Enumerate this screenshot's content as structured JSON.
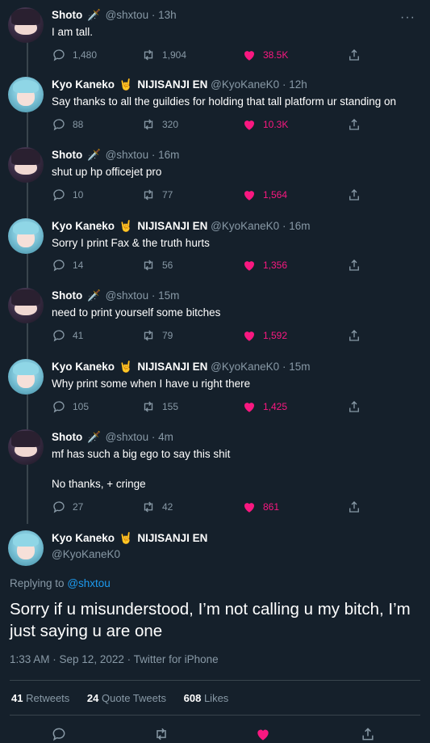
{
  "thread": [
    {
      "name": "Shoto",
      "emoji": "🗡️",
      "handle": "@shxtou",
      "time": "13h",
      "text": [
        "I am tall."
      ],
      "replies": "1,480",
      "retweets": "1,904",
      "likes": "38.5K"
    },
    {
      "name": "Kyo Kaneko",
      "emoji": "🤘",
      "suffix": "NIJISANJI EN",
      "handle": "@KyoKaneK0",
      "time": "12h",
      "text": [
        "Say thanks to all the guildies for holding that tall platform ur standing on"
      ],
      "replies": "88",
      "retweets": "320",
      "likes": "10.3K"
    },
    {
      "name": "Shoto",
      "emoji": "🗡️",
      "handle": "@shxtou",
      "time": "16m",
      "text": [
        "shut up hp officejet pro"
      ],
      "replies": "10",
      "retweets": "77",
      "likes": "1,564"
    },
    {
      "name": "Kyo Kaneko",
      "emoji": "🤘",
      "suffix": "NIJISANJI EN",
      "handle": "@KyoKaneK0",
      "time": "16m",
      "text": [
        "Sorry I print Fax & the truth hurts"
      ],
      "replies": "14",
      "retweets": "56",
      "likes": "1,356"
    },
    {
      "name": "Shoto",
      "emoji": "🗡️",
      "handle": "@shxtou",
      "time": "15m",
      "text": [
        "need to print yourself some bitches"
      ],
      "replies": "41",
      "retweets": "79",
      "likes": "1,592"
    },
    {
      "name": "Kyo Kaneko",
      "emoji": "🤘",
      "suffix": "NIJISANJI EN",
      "handle": "@KyoKaneK0",
      "time": "15m",
      "text": [
        "Why print some when I have u right there"
      ],
      "replies": "105",
      "retweets": "155",
      "likes": "1,425"
    },
    {
      "name": "Shoto",
      "emoji": "🗡️",
      "handle": "@shxtou",
      "time": "4m",
      "text": [
        "mf has such a big ego to say this shit",
        "No thanks, + cringe"
      ],
      "replies": "27",
      "retweets": "42",
      "likes": "861"
    }
  ],
  "main": {
    "name": "Kyo Kaneko",
    "emoji": "🤘",
    "suffix": "NIJISANJI EN",
    "handle": "@KyoKaneK0",
    "replying_label": "Replying to",
    "replying_to": "@shxtou",
    "text": "Sorry if u misunderstood, I’m not calling u my bitch, I’m just saying u are one",
    "meta": "1:33 AM · Sep 12, 2022 · Twitter for iPhone",
    "retweets": "41",
    "retweets_label": "Retweets",
    "quotes": "24",
    "quotes_label": "Quote Tweets",
    "likes": "608",
    "likes_label": "Likes"
  },
  "dot": "·",
  "colors": {
    "bg": "#15202b",
    "muted": "#8899a6",
    "like": "#f91880",
    "link": "#1d9bf0",
    "line": "#38444d"
  }
}
